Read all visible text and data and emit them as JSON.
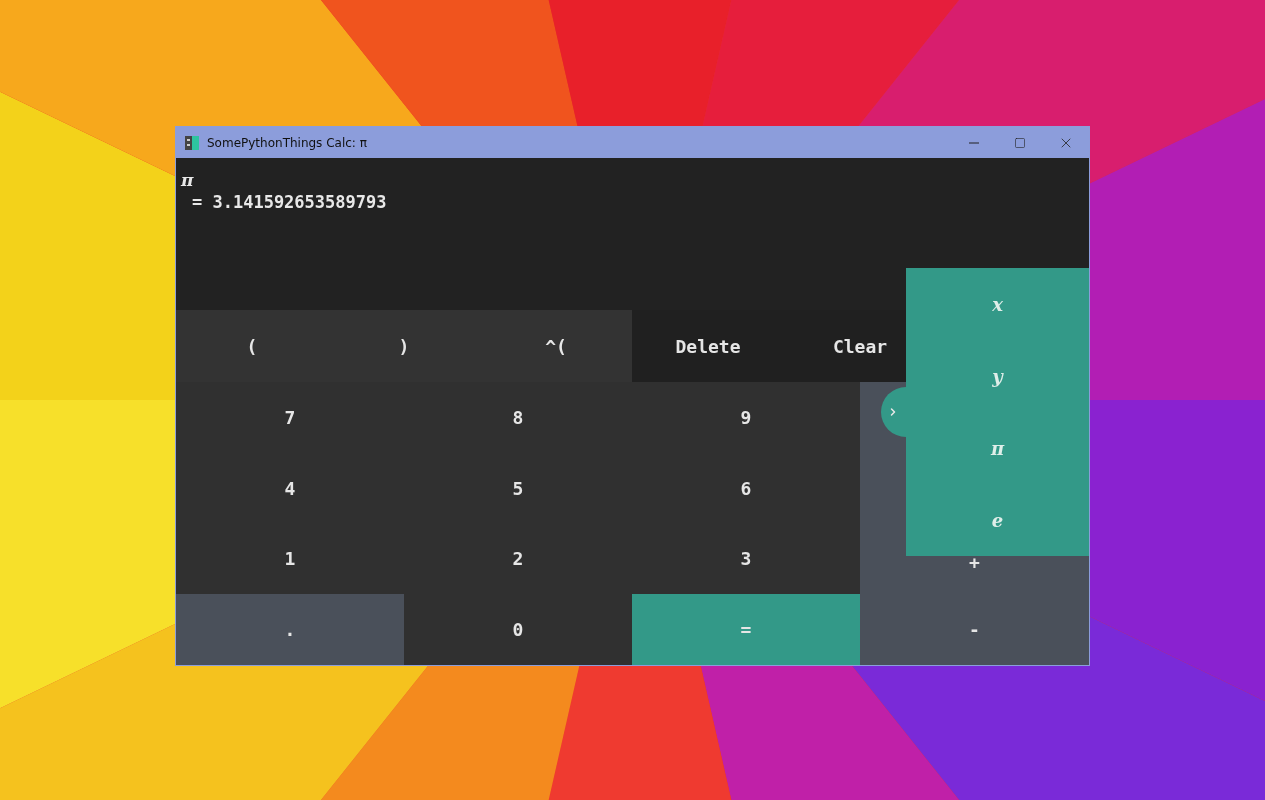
{
  "window": {
    "title": "SomePythonThings Calc: π"
  },
  "display": {
    "expression": "π",
    "result": "= 3.141592653589793"
  },
  "top_keys": [
    {
      "label": "(",
      "kind": "function"
    },
    {
      "label": ")",
      "kind": "function"
    },
    {
      "label": "^(",
      "kind": "function"
    },
    {
      "label": "Delete",
      "kind": "action"
    },
    {
      "label": "Clear",
      "kind": "action"
    }
  ],
  "keypad": [
    {
      "label": "7",
      "kind": "digit"
    },
    {
      "label": "8",
      "kind": "digit"
    },
    {
      "label": "9",
      "kind": "digit"
    },
    {
      "label": "4",
      "kind": "digit"
    },
    {
      "label": "5",
      "kind": "digit"
    },
    {
      "label": "6",
      "kind": "digit"
    },
    {
      "label": "1",
      "kind": "digit"
    },
    {
      "label": "2",
      "kind": "digit"
    },
    {
      "label": "3",
      "kind": "digit"
    },
    {
      "label": ".",
      "kind": "dot"
    },
    {
      "label": "0",
      "kind": "digit"
    },
    {
      "label": "=",
      "kind": "equals"
    }
  ],
  "operators": [
    "+",
    "-"
  ],
  "side_panel": {
    "expanded": true,
    "items": [
      "x",
      "y",
      "π",
      "e"
    ]
  }
}
